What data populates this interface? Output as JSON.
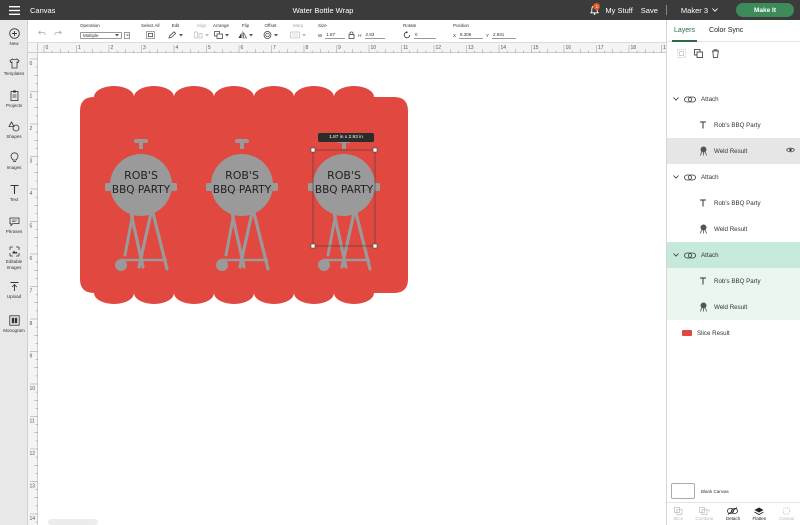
{
  "app": {
    "title": "Canvas",
    "project_title": "Water Bottle Wrap"
  },
  "topbar": {
    "notification_count": "1",
    "my_stuff": "My Stuff",
    "save": "Save",
    "machine": "Maker 3",
    "make_it": "Make It"
  },
  "toolbar": {
    "operation": {
      "label": "Operation",
      "value": "Multiple"
    },
    "select_all": "Select All",
    "edit": "Edit",
    "align": "Align",
    "arrange": "Arrange",
    "flip": "Flip",
    "offset": "Offset",
    "warp": "Warp",
    "size": {
      "label": "Size",
      "w_label": "W",
      "w_value": "1.87",
      "h_label": "H",
      "h_value": "2.93"
    },
    "rotate": {
      "label": "Rotate",
      "value": "0"
    },
    "position": {
      "label": "Position",
      "x_label": "X",
      "x_value": "8.306",
      "y_label": "Y",
      "y_value": "2.931"
    }
  },
  "sidebar": {
    "items": [
      {
        "label": "New",
        "icon": "plus-circle-icon"
      },
      {
        "label": "Templates",
        "icon": "shirt-icon"
      },
      {
        "label": "Projects",
        "icon": "clipboard-icon"
      },
      {
        "label": "Shapes",
        "icon": "shapes-icon"
      },
      {
        "label": "Images",
        "icon": "lightbulb-icon"
      },
      {
        "label": "Text",
        "icon": "text-icon"
      },
      {
        "label": "Phrases",
        "icon": "speech-bubble-icon"
      },
      {
        "label": "Editable Images",
        "icon": "editable-image-icon"
      },
      {
        "label": "Upload",
        "icon": "upload-icon"
      },
      {
        "label": "Monogram",
        "icon": "monogram-icon"
      }
    ]
  },
  "rulers": {
    "top": [
      "0",
      "1",
      "2",
      "3",
      "4",
      "5",
      "6",
      "7",
      "8",
      "9",
      "10",
      "11",
      "12",
      "13",
      "14",
      "15",
      "16",
      "17",
      "18",
      "19"
    ],
    "left": [
      "0",
      "1",
      "2",
      "3",
      "4",
      "5",
      "6",
      "7",
      "8",
      "9",
      "10",
      "11",
      "12",
      "13",
      "14"
    ]
  },
  "canvas": {
    "selection_tip": "1.87 in x 2.93 in",
    "design_text": [
      "ROB'S",
      "BBQ PARTY"
    ],
    "colors": {
      "wrap": "#e04840",
      "grill": "#9a9a9a",
      "text": "#222222"
    }
  },
  "panel": {
    "tabs": [
      "Layers",
      "Color Sync"
    ],
    "groups": [
      {
        "label": "Attach",
        "children": [
          "Rob's BBQ Party",
          "Weld Result"
        ]
      },
      {
        "label": "Attach",
        "children": [
          "Rob's BBQ Party",
          "Weld Result"
        ]
      },
      {
        "label": "Attach",
        "children": [
          "Rob's BBQ Party",
          "Weld Result"
        ]
      }
    ],
    "slice": "Slice Result",
    "blank_canvas": "Blank Canvas",
    "actions": [
      "Slice",
      "Combine",
      "Detach",
      "Flatten",
      "Contour"
    ]
  }
}
